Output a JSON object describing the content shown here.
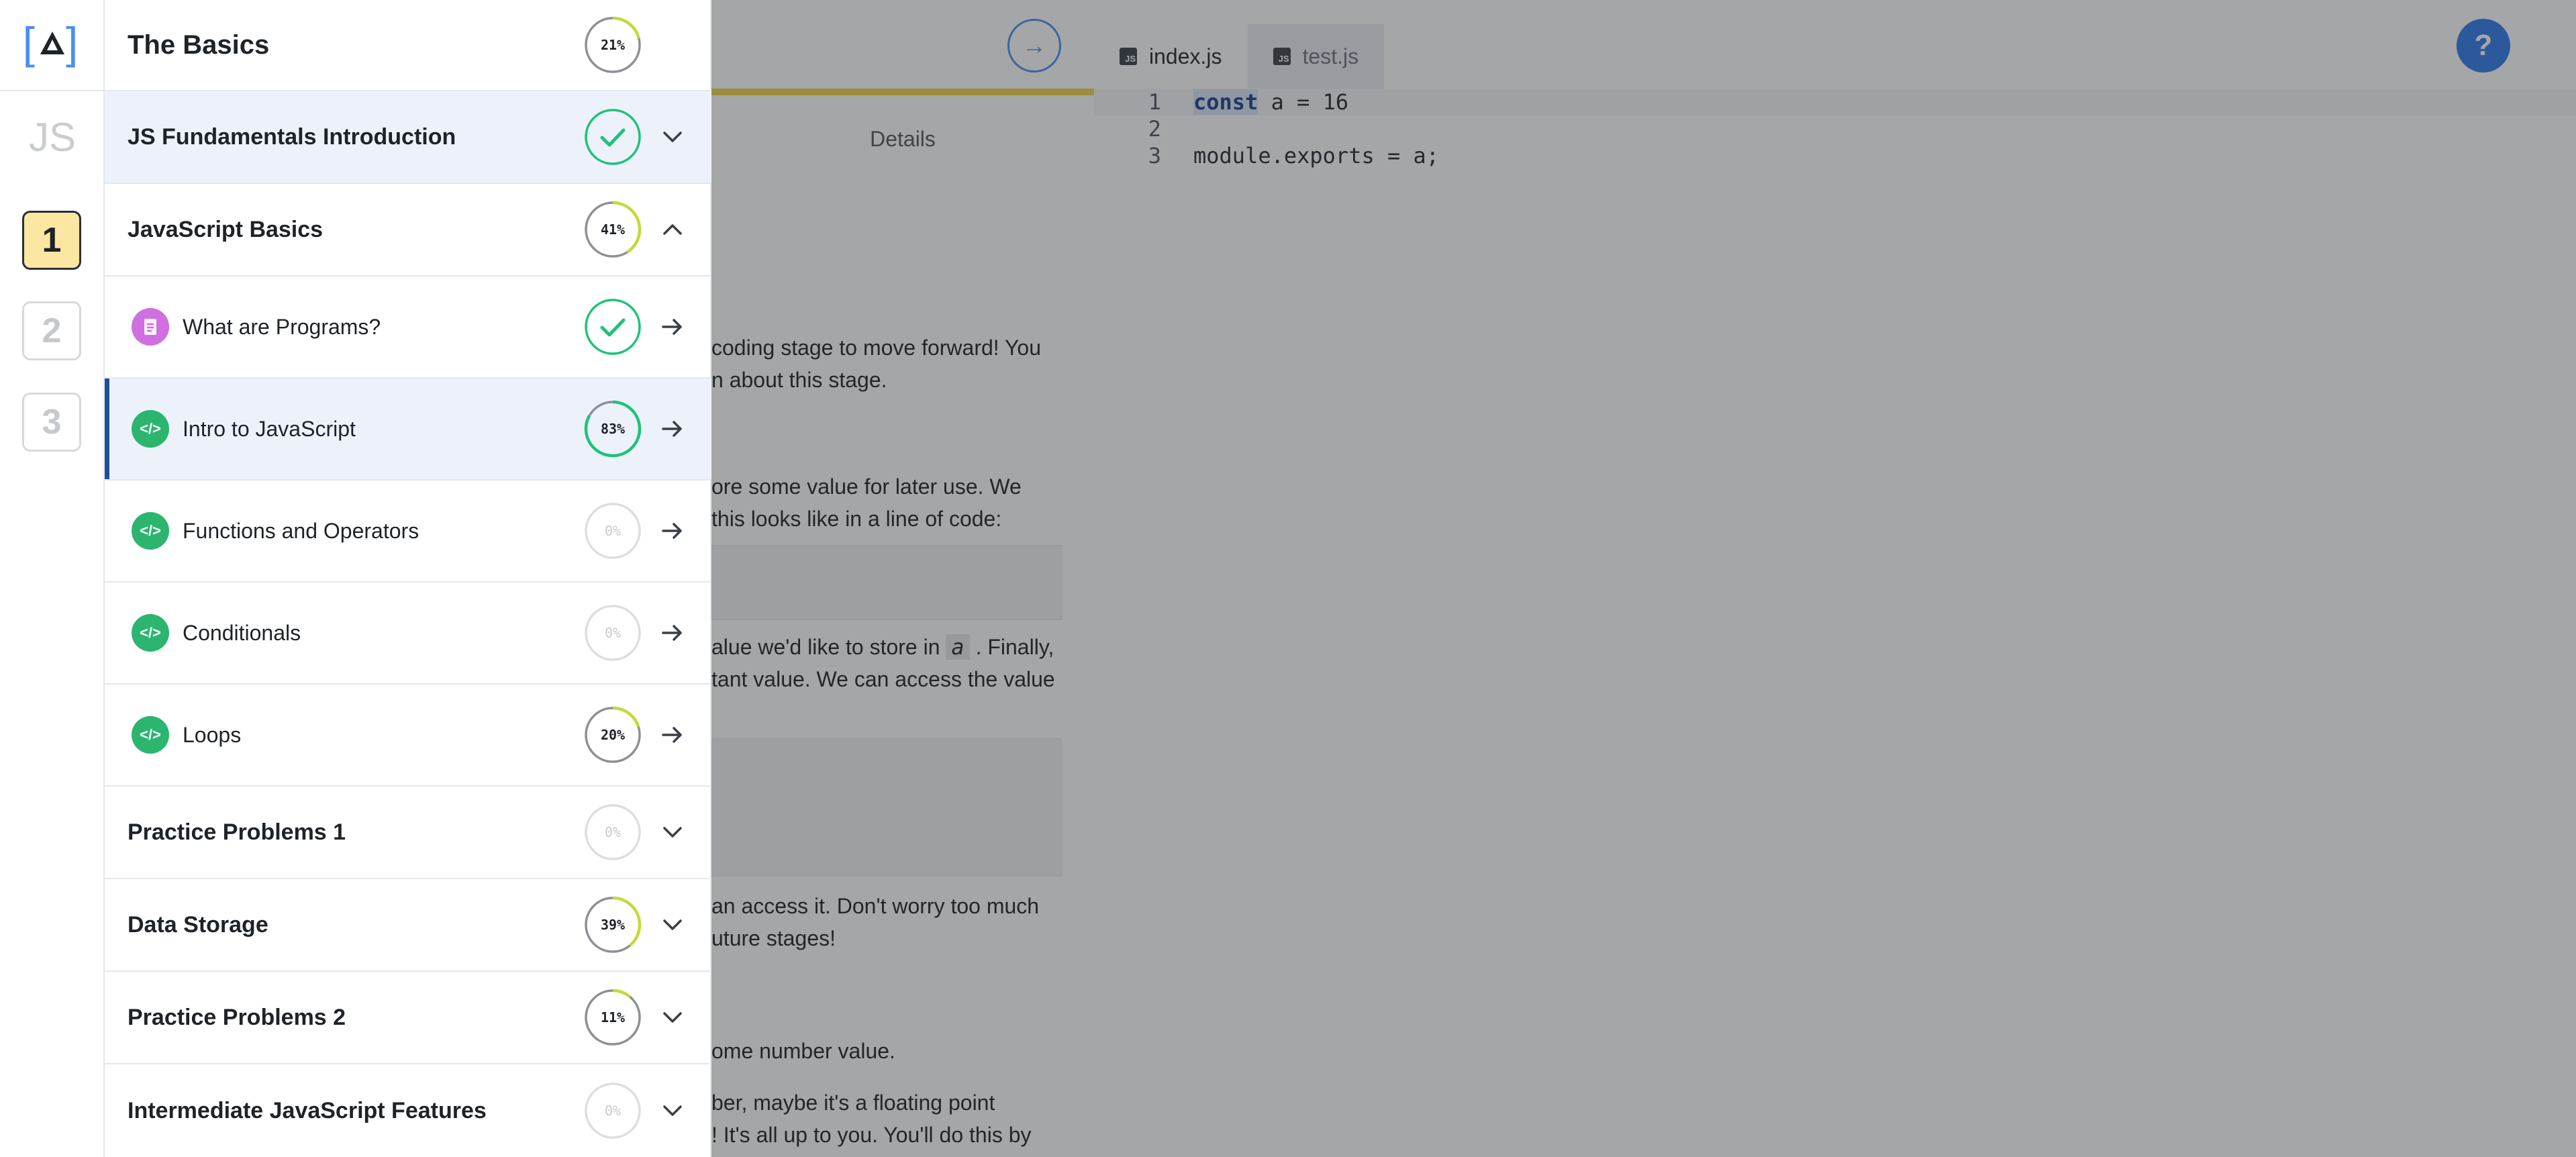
{
  "nav": {
    "header": {
      "title": "The Basics",
      "progress": 21
    },
    "sections": [
      {
        "id": "fundamentals",
        "title": "JS Fundamentals Introduction",
        "progress": 100,
        "complete": true,
        "expanded": false
      },
      {
        "id": "basics",
        "title": "JavaScript Basics",
        "progress": 41,
        "complete": false,
        "expanded": true
      }
    ],
    "lessons": [
      {
        "title": "What are Programs?",
        "type": "doc",
        "progress": 100,
        "complete": true,
        "current": false
      },
      {
        "title": "Intro to JavaScript",
        "type": "code",
        "progress": 83,
        "complete": false,
        "current": true
      },
      {
        "title": "Functions and Operators",
        "type": "code",
        "progress": 0,
        "complete": false,
        "current": false
      },
      {
        "title": "Conditionals",
        "type": "code",
        "progress": 0,
        "complete": false,
        "current": false
      },
      {
        "title": "Loops",
        "type": "code",
        "progress": 20,
        "complete": false,
        "current": false
      }
    ],
    "more_sections": [
      {
        "title": "Practice Problems 1",
        "progress": 0
      },
      {
        "title": "Data Storage",
        "progress": 39
      },
      {
        "title": "Practice Problems 2",
        "progress": 11
      },
      {
        "title": "Intermediate JavaScript Features",
        "progress": 0
      }
    ],
    "code_icon_text": "</>"
  },
  "rail": {
    "logo_left": "[",
    "logo_right": "]",
    "js_label": "JS",
    "steps": [
      "1",
      "2",
      "3"
    ],
    "active_step": "1"
  },
  "lesson": {
    "next_arrow": "→",
    "details_label": "Details",
    "text_lines": [
      "coding stage to move forward! You",
      "n about this stage.",
      "ore some value for later use. We",
      "this looks like in a line of code:",
      "alue we'd like to store in",
      ". Finally,",
      "tant value. We can access the value",
      "an access it. Don't worry too much",
      "uture stages!",
      "ome number value.",
      "ber, maybe it's a floating point",
      "! It's all up to you. You'll do this by"
    ],
    "inline_var": "a"
  },
  "editor": {
    "tabs": [
      {
        "label": "index.js",
        "active": true
      },
      {
        "label": "test.js",
        "active": false
      }
    ],
    "js_badge": "JS",
    "help_label": "?",
    "lines": [
      {
        "n": "1",
        "kw": "const",
        "rest": " a = 16"
      },
      {
        "n": "2",
        "kw": "",
        "rest": ""
      },
      {
        "n": "3",
        "kw": "",
        "rest": "module.exports = a;"
      }
    ]
  },
  "colors": {
    "complete_green": "#1fc27a",
    "partial_lime": "#c6d83a",
    "ring_grey": "#b9bcc1",
    "accent_blue": "#2f7be8",
    "current_bar": "#1f4f9a"
  }
}
